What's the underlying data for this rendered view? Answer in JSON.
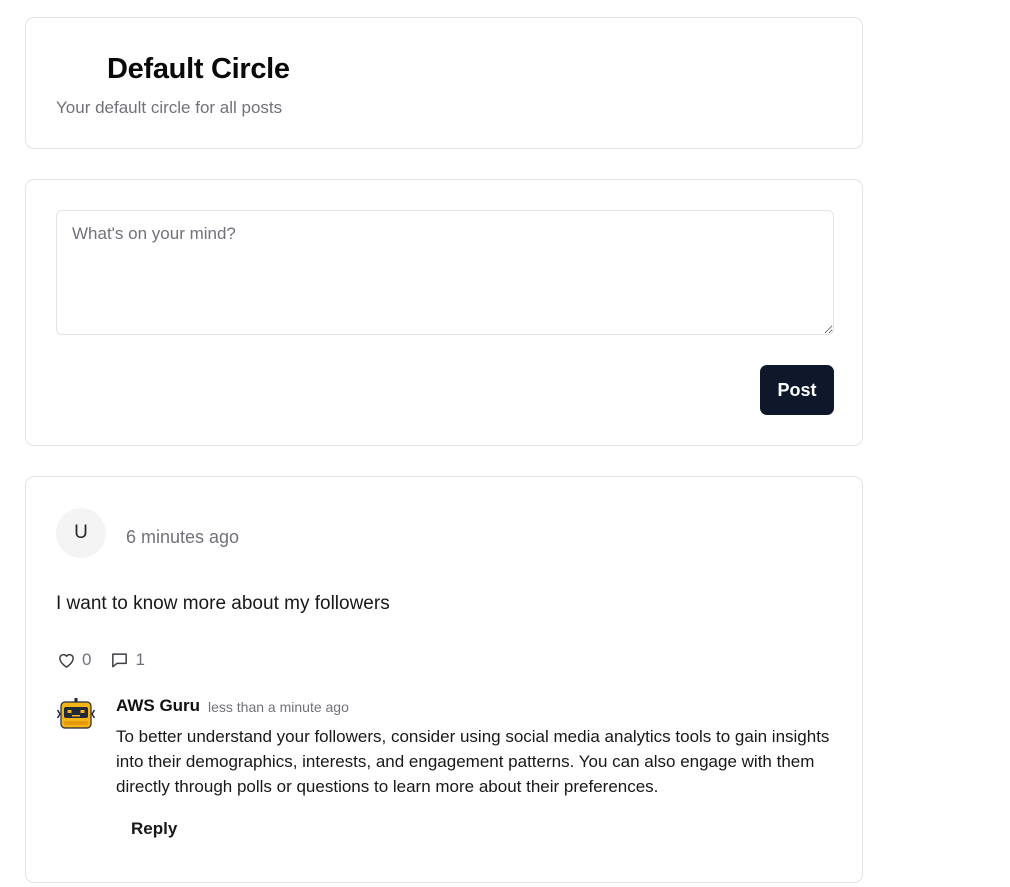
{
  "circle": {
    "title": "Default Circle",
    "description": "Your default circle for all posts"
  },
  "composer": {
    "placeholder": "What's on your mind?",
    "value": "",
    "post_label": "Post"
  },
  "post": {
    "avatar_initial": "U",
    "time": "6 minutes ago",
    "body": "I want to know more about my followers",
    "like_count": "0",
    "comment_count": "1",
    "icons": {
      "like": "heart-icon",
      "comment": "comment-icon"
    },
    "comments": [
      {
        "author": "AWS Guru",
        "avatar_icon": "robot-icon",
        "time": "less than a minute ago",
        "text": "To better understand your followers, consider using social media analytics tools to gain insights into their demographics, interests, and engagement patterns. You can also engage with them directly through polls or questions to learn more about their preferences.",
        "reply_label": "Reply"
      }
    ]
  },
  "colors": {
    "primary_button": "#0f172a",
    "muted_text": "#71717a",
    "border": "#e4e4e7",
    "robot_avatar": "#f5b417"
  }
}
